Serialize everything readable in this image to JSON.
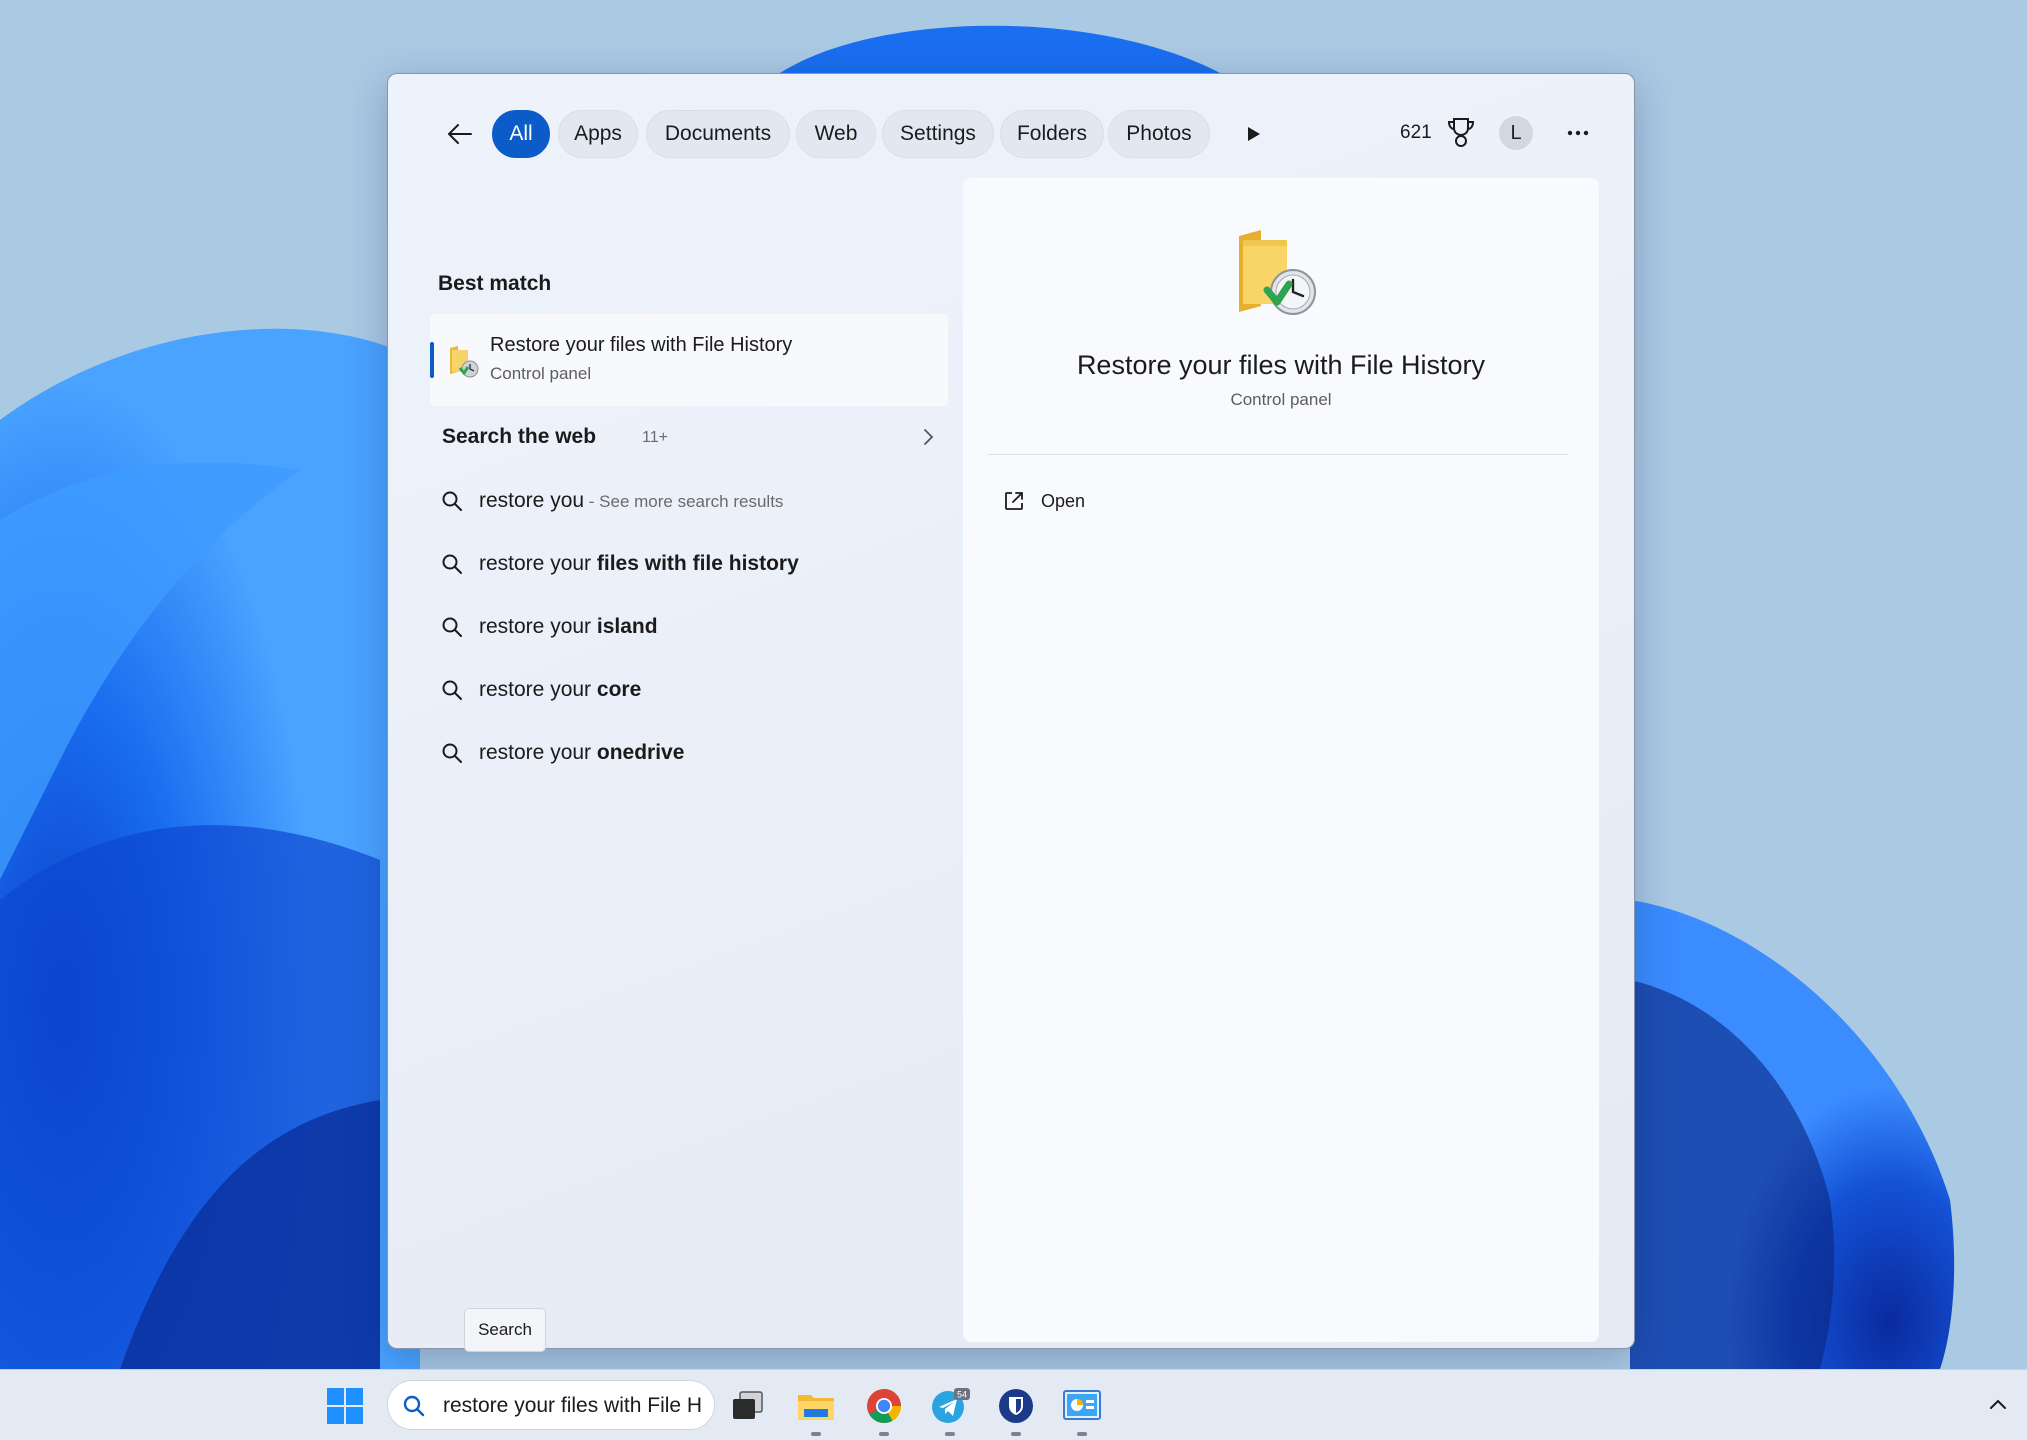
{
  "search_panel": {
    "filters": [
      {
        "label": "All",
        "active": true
      },
      {
        "label": "Apps",
        "active": false
      },
      {
        "label": "Documents",
        "active": false
      },
      {
        "label": "Web",
        "active": false
      },
      {
        "label": "Settings",
        "active": false
      },
      {
        "label": "Folders",
        "active": false
      },
      {
        "label": "Photos",
        "active": false
      }
    ],
    "rewards_points": "621",
    "account_initial": "L",
    "best_match": {
      "heading": "Best match",
      "title": "Restore your files with File History",
      "subtitle": "Control panel",
      "icon": "file-history-folder-icon"
    },
    "search_web": {
      "heading": "Search the web",
      "count": "11+"
    },
    "suggestions": [
      {
        "prefix": "restore you",
        "bold": "",
        "hint": " - See more search results"
      },
      {
        "prefix": "restore your ",
        "bold": "files with file history",
        "hint": ""
      },
      {
        "prefix": "restore your ",
        "bold": "island",
        "hint": ""
      },
      {
        "prefix": "restore your ",
        "bold": "core",
        "hint": ""
      },
      {
        "prefix": "restore your ",
        "bold": "onedrive",
        "hint": ""
      }
    ],
    "detail": {
      "title": "Restore your files with File History",
      "subtitle": "Control panel",
      "actions": [
        {
          "label": "Open",
          "icon": "open-external-icon"
        }
      ]
    }
  },
  "tooltip": "Search",
  "taskbar": {
    "search_value": "restore your files with File H",
    "apps": [
      {
        "name": "task-view",
        "icon": "task-view-icon"
      },
      {
        "name": "file-explorer",
        "icon": "folder-icon"
      },
      {
        "name": "chrome",
        "icon": "chrome-icon"
      },
      {
        "name": "telegram",
        "icon": "telegram-icon",
        "badge": "54"
      },
      {
        "name": "bitwarden",
        "icon": "shield-icon"
      },
      {
        "name": "control-panel",
        "icon": "control-panel-icon"
      }
    ]
  },
  "colors": {
    "accent": "#0b5cc8",
    "wallpaper_blue": "#1565e8"
  }
}
